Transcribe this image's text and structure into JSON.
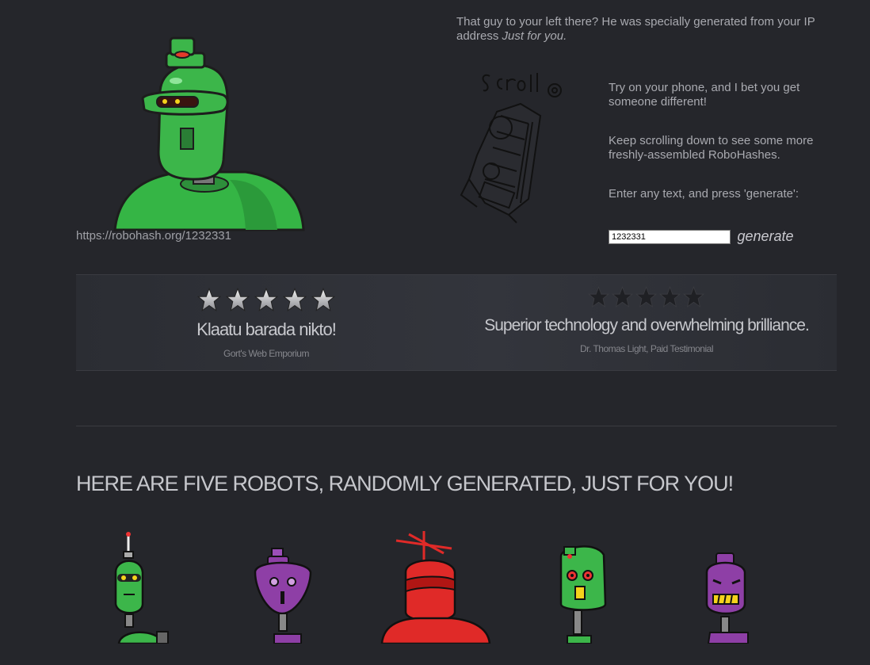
{
  "hero": {
    "url": "https://robohash.org/1232331",
    "robot_icon": "green-robot-image"
  },
  "intro": {
    "line": "That guy to your left there? He was specially generated from your IP address",
    "emphasis": "Just for you."
  },
  "scroll_sketch_icon": "scroll-hand-drawn-robot",
  "side": {
    "phone": "Try on your phone, and I bet you get someone different!",
    "keep": "Keep scrolling down to see some more freshly-assembled RoboHashes.",
    "enter": "Enter any text, and press 'generate':"
  },
  "form": {
    "input_value": "1232331",
    "button_label": "generate"
  },
  "testimonials": [
    {
      "stars": 5,
      "quote": "Klaatu barada nikto!",
      "author": "Gort's Web Emporium"
    },
    {
      "stars": 5,
      "quote": "Superior technology and overwhelming brilliance.",
      "author": "Dr. Thomas Light, Paid Testimonial"
    }
  ],
  "five_heading": "HERE ARE FIVE ROBOTS, RANDOMLY GENERATED, JUST FOR YOU!",
  "colors": {
    "background": "#25262b",
    "robot_green": "#3cb64a",
    "robot_purple": "#8e3fa6",
    "robot_red": "#e02a28"
  }
}
